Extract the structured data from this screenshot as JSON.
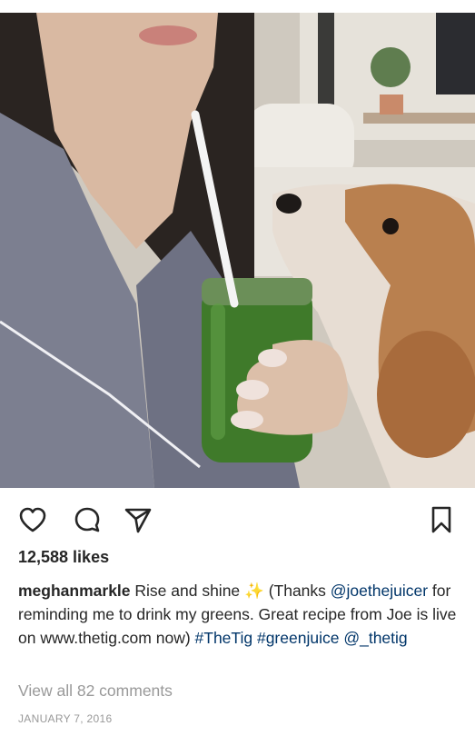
{
  "post": {
    "image_alt": "Woman in a satin robe holding a green juice with a straw next to a beagle",
    "likes": "12,588 likes",
    "caption": {
      "username": "meghanmarkle",
      "text_1": " Rise and shine ",
      "emoji_icon": "sparkle-emoji",
      "text_2": " (Thanks ",
      "mention_1": "@joethejuicer",
      "text_3": " for reminding me to drink my greens. Great recipe from Joe is live on www.thetig.com now) ",
      "hashtag_1": "#TheTig",
      "hashtag_2": "#greenjuice",
      "mention_2": "@_thetig"
    },
    "view_comments": "View all 82 comments",
    "date": "JANUARY 7, 2016"
  },
  "icons": {
    "like": "heart-icon",
    "comment": "comment-icon",
    "share": "send-icon",
    "save": "bookmark-icon"
  },
  "colors": {
    "link": "#003569",
    "muted": "#999999",
    "text": "#262626"
  }
}
